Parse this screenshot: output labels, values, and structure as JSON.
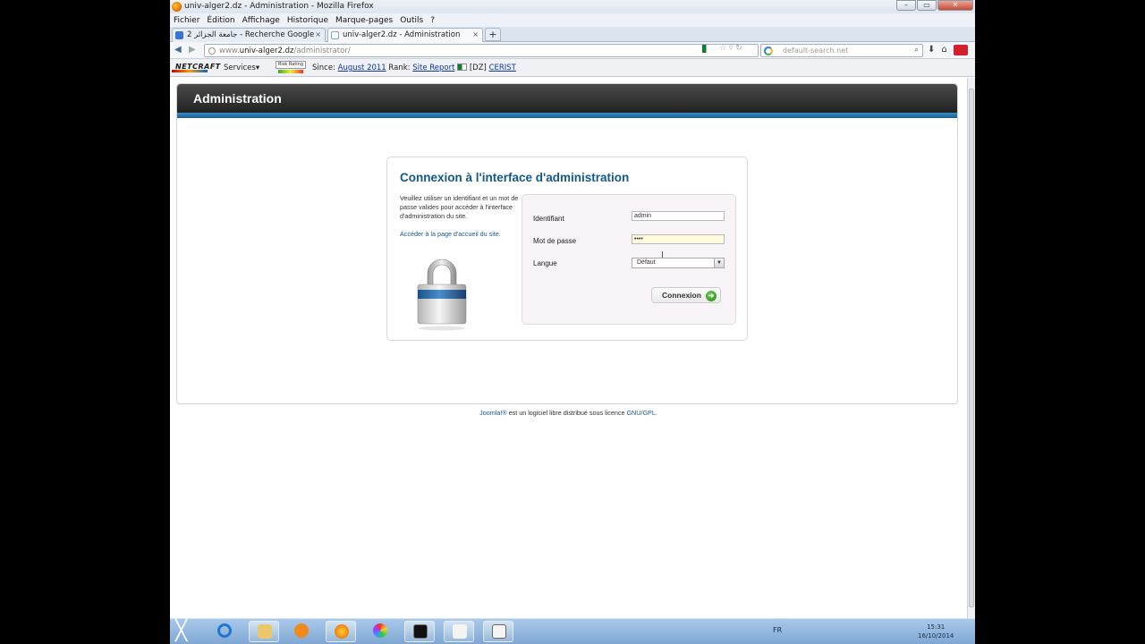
{
  "window": {
    "title": "univ-alger2.dz - Administration - Mozilla Firefox",
    "controls": [
      "–",
      "▭",
      "✕"
    ]
  },
  "menu": [
    "Fichier",
    "Édition",
    "Affichage",
    "Historique",
    "Marque-pages",
    "Outils",
    "?"
  ],
  "tabs": [
    {
      "label": "جامعة الجزائر 2 - Recherche Google",
      "close": "×"
    },
    {
      "label": "univ-alger2.dz - Administration",
      "close": "×"
    }
  ],
  "new_tab": "+",
  "nav": {
    "back": "◀",
    "forward": "▶",
    "url_prefix": "www.",
    "url_host": "univ-alger2.dz",
    "url_path": "/administrator/",
    "url_icons": "☆ ▿  ↻",
    "search_placeholder": "default-search.net",
    "search_glyph": "⌕",
    "right_icons": [
      "⬇",
      "⌂"
    ]
  },
  "netcraft": {
    "logo": "NETCRAFT",
    "services": "Services▾",
    "risk": "Risk Rating",
    "since_label": "Since:",
    "since_value": "August 2011",
    "rank_label": "Rank:",
    "rank_value": "Site Report",
    "country": "[DZ]",
    "host": "CERIST"
  },
  "page": {
    "header_title": "Administration",
    "login_title": "Connexion à l'interface d'administration",
    "intro_text": "Veuillez utiliser un identifiant et un mot de passe valides pour accéder à l'interface d'administration du site.",
    "home_link": "Accéder à la page d'accueil du site.",
    "username_label": "Identifiant",
    "username_value": "admin",
    "password_label": "Mot de passe",
    "password_value": "••••",
    "language_label": "Langue",
    "language_value": "Défaut",
    "select_arrow": "▼",
    "submit_label": "Connexion",
    "submit_glyph": "➜",
    "footer_link1": "Joomla!®",
    "footer_text": " est un logiciel libre distribué sous licence ",
    "footer_link2": "GNU/GPL",
    "footer_end": "."
  },
  "taskbar": {
    "start_glyph": "╳",
    "tray_text": "FR",
    "time": "15:31",
    "date": "16/10/2014"
  },
  "colors": {
    "accent_blue": "#14578a",
    "header_stripe": "#2f7fb8",
    "firefox_orange": "#e66000"
  }
}
